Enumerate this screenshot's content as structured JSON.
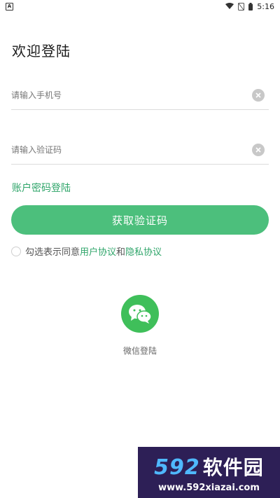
{
  "status_bar": {
    "notification_icon": "A",
    "time": "5:16"
  },
  "page_title": "欢迎登陆",
  "phone_input": {
    "placeholder": "请输入手机号",
    "value": ""
  },
  "code_input": {
    "placeholder": "请输入验证码",
    "value": ""
  },
  "password_login_label": "账户密码登陆",
  "get_code_label": "获取验证码",
  "agreement": {
    "prefix": "勾选表示同意",
    "user_agreement": "用户协议",
    "conjunction": "和",
    "privacy_agreement": "隐私协议"
  },
  "wechat_login_label": "微信登陆",
  "watermark": {
    "number": "592",
    "brand": "软件园",
    "url": "www.592xiazai.com"
  },
  "colors": {
    "accent": "#4cbf7c",
    "link": "#2fa56a",
    "wechat": "#3fbf5a"
  },
  "icons": [
    "wifi-icon",
    "no-sim-icon",
    "battery-icon",
    "clear-icon",
    "wechat-icon"
  ]
}
